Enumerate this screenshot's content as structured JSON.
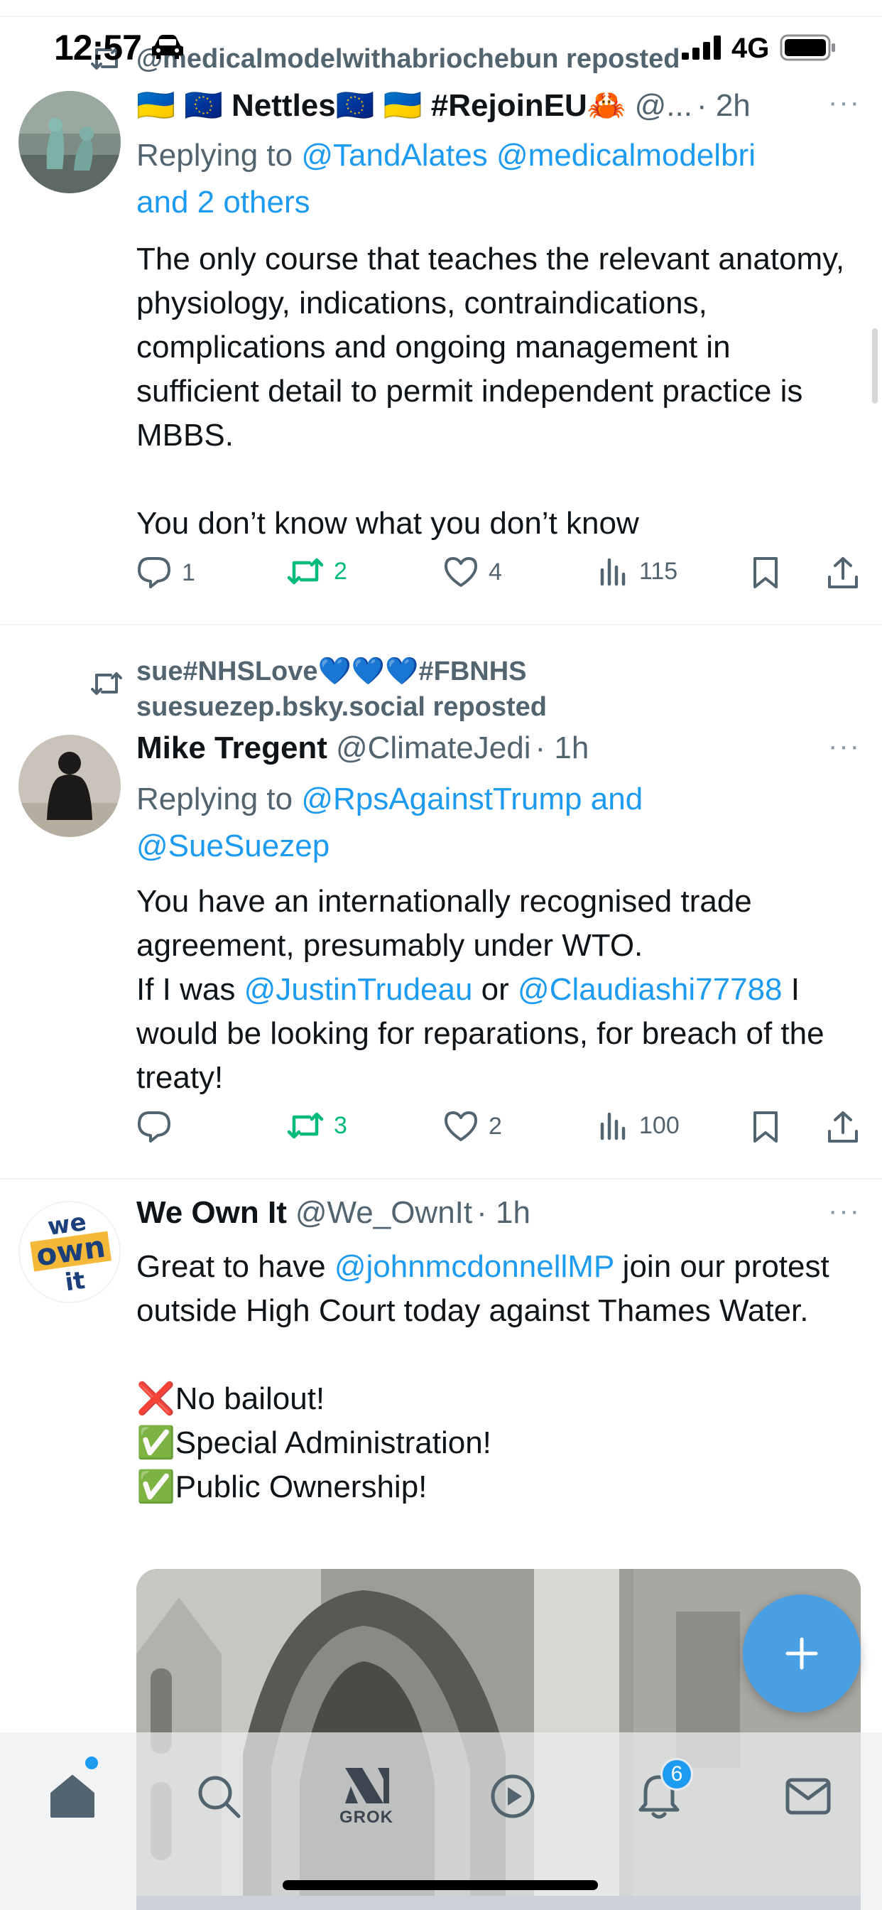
{
  "status_bar": {
    "time": "12:57",
    "network": "4G"
  },
  "tweets": [
    {
      "reposted_by": "@medicalmodelwithabriochebun reposted",
      "name": "🇺🇦 🇪🇺 Nettles🇪🇺 🇺🇦 #RejoinEU🦀",
      "handle": "@...",
      "time": "· 2h",
      "replying_prefix": "Replying to ",
      "replying_to": "@TandAlates @medicalmodelbri",
      "replying_more": "and 2 others",
      "body_1": "The only course that teaches the relevant anatomy, physiology, indications, contraindications, complications and ongoing management in sufficient detail to permit independent practice is MBBS.",
      "body_2": "You don’t know what you don’t know",
      "replies": "1",
      "reposts": "2",
      "likes": "4",
      "views": "115"
    },
    {
      "reposted_by_1": "sue#NHSLove💙💙💙#FBNHS",
      "reposted_by_2": "suesuezep.bsky.social reposted",
      "name": "Mike Tregent",
      "handle": "@ClimateJedi",
      "time": "· 1h",
      "replying_prefix": "Replying to ",
      "replying_to": "@RpsAgainstTrump and",
      "replying_more": "@SueSuezep",
      "body_a": "You have an internationally recognised trade agreement, presumably under WTO.",
      "body_b": "If I was ",
      "mention_1": "@JustinTrudeau",
      "body_c": " or ",
      "mention_2": "@Claudiashi77788",
      "body_d": " I would be looking for reparations, for breach of the treaty!",
      "replies": "",
      "reposts": "3",
      "likes": "2",
      "views": "100"
    },
    {
      "name": "We Own It",
      "handle": "@We_OwnIt",
      "time": "· 1h",
      "body_a": "Great to have ",
      "mention": "@johnmcdonnellMP",
      "body_b": " join our protest outside High Court today against Thames Water.",
      "line_1": "❌No bailout!",
      "line_2": "✅Special Administration!",
      "line_3": "✅Public Ownership!",
      "avatar_text_1": "we",
      "avatar_text_2": "own",
      "avatar_text_3": "it"
    }
  ],
  "tabbar": {
    "grok_label": "GROK",
    "notifications_badge": "6"
  },
  "more_label": "···",
  "icons": [
    "car-icon",
    "signal-icon",
    "battery-icon",
    "repost-icon",
    "reply-icon",
    "like-icon",
    "views-icon",
    "bookmark-icon",
    "share-icon",
    "plus-icon",
    "home-icon",
    "search-icon",
    "grok-icon",
    "play-icon",
    "bell-icon",
    "mail-icon"
  ],
  "colors": {
    "accent": "#1d9bf0",
    "repost_active": "#00ba7c",
    "secondary_text": "#536471",
    "fab": "#4a9fe2"
  }
}
